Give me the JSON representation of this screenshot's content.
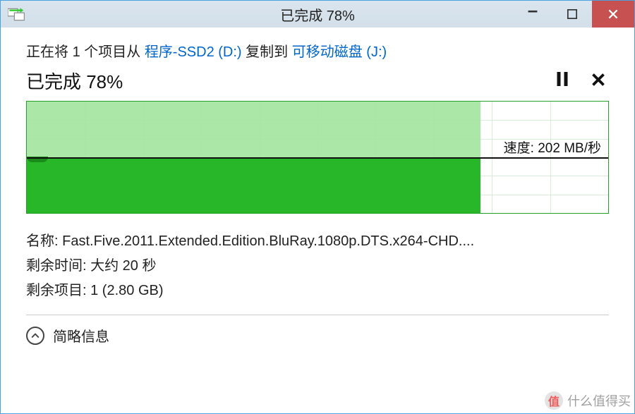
{
  "titlebar": {
    "title": "已完成 78%"
  },
  "copy": {
    "prefix": "正在将 ",
    "count": "1",
    "mid": " 个项目从 ",
    "source": "程序-SSD2 (D:)",
    "mid2": " 复制到 ",
    "dest": "可移动磁盘 (J:)"
  },
  "status": {
    "text": "已完成 78%"
  },
  "speed": {
    "label": "速度: 202 MB/秒"
  },
  "details": {
    "name_label": "名称: ",
    "name_value": "Fast.Five.2011.Extended.Edition.BluRay.1080p.DTS.x264-CHD....",
    "time_label": "剩余时间: ",
    "time_value": "大约 20 秒",
    "items_label": "剩余项目: ",
    "items_value": "1 (2.80 GB)"
  },
  "toggle": {
    "label": "简略信息"
  },
  "watermark": {
    "badge": "值",
    "text": "什么值得买"
  },
  "chart_data": {
    "type": "area",
    "title": "",
    "xlabel": "",
    "ylabel": "速度",
    "ylim": [
      0,
      400
    ],
    "progress_percent": 78,
    "current_speed_mb_s": 202,
    "x": [
      0,
      10,
      20,
      30,
      40,
      50,
      60,
      70,
      78
    ],
    "values": [
      200,
      195,
      200,
      198,
      200,
      197,
      200,
      198,
      202
    ]
  }
}
